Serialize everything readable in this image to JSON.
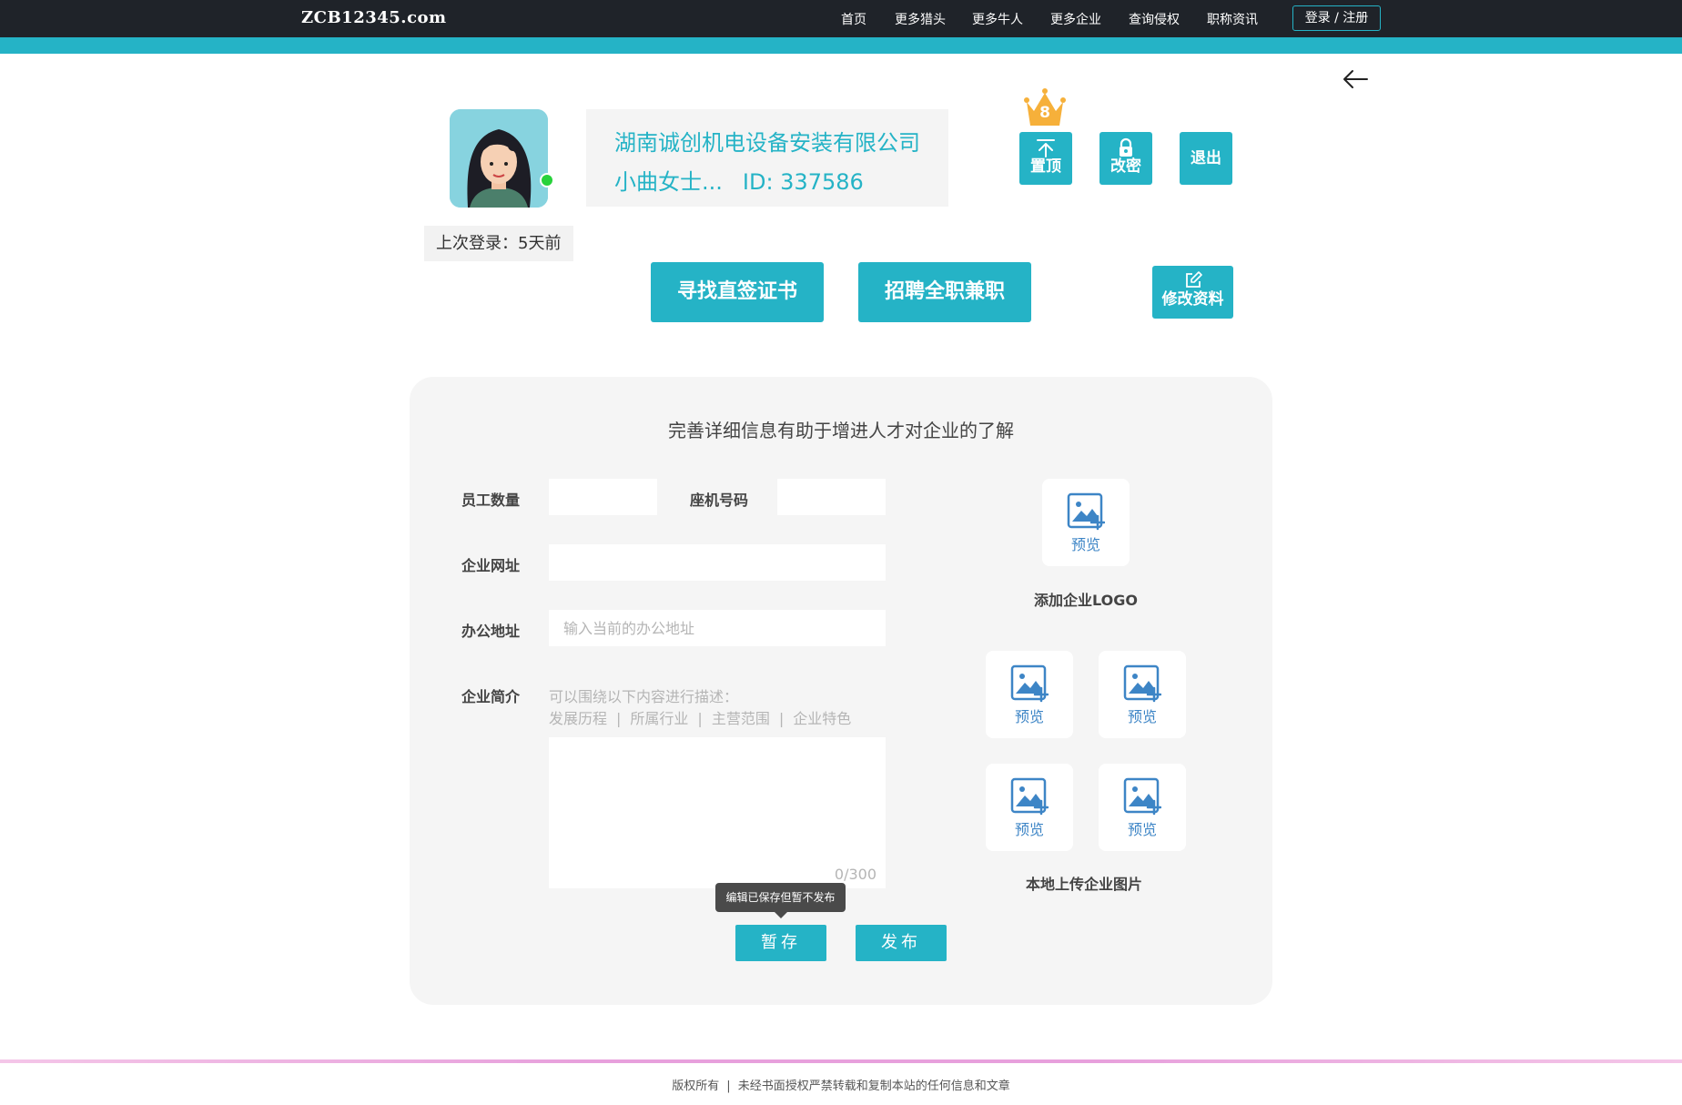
{
  "header": {
    "brand": "ZCB12345.com",
    "nav": [
      "首页",
      "更多猎头",
      "更多牛人",
      "更多企业",
      "查询侵权",
      "职称资讯"
    ],
    "login_label": "登录 / 注册"
  },
  "profile": {
    "company_name": "湖南诚创机电设备安装有限公司",
    "user_name": "小曲女士...",
    "user_id": "ID: 337586",
    "last_login": "上次登录：5天前",
    "crown_count": "8",
    "online": true
  },
  "actions": {
    "pin_label": "置顶",
    "change_pwd_label": "改密",
    "logout_label": "退出",
    "find_cert_label": "寻找直签证书",
    "recruit_label": "招聘全职兼职",
    "edit_profile_label": "修改资料"
  },
  "form": {
    "title": "完善详细信息有助于增进人才对企业的了解",
    "employees_label": "员工数量",
    "employees_value": "",
    "phone_label": "座机号码",
    "phone_value": "",
    "website_label": "企业网址",
    "website_value": "",
    "address_label": "办公地址",
    "address_placeholder": "输入当前的办公地址",
    "intro_label": "企业简介",
    "intro_hint": "可以围绕以下内容进行描述：",
    "intro_topics": [
      "发展历程",
      "所属行业",
      "主营范围",
      "企业特色"
    ],
    "intro_separator": "|",
    "intro_counter": "0/300",
    "tooltip": "编辑已保存但暂不发布",
    "save_label": "暂存",
    "publish_label": "发布"
  },
  "uploads": {
    "logo_preview": "预览",
    "logo_caption": "添加企业LOGO",
    "image_previews": [
      "预览",
      "预览",
      "预览",
      "预览"
    ],
    "images_caption": "本地上传企业图片"
  },
  "footer": {
    "copyright": "版权所有",
    "separator": "|",
    "notice": "未经书面授权严禁转载和复制本站的任何信息和文章"
  },
  "colors": {
    "accent": "#25b3c6",
    "topbar": "#1f2329",
    "preview_text": "#3d85c6",
    "online": "#27d23b"
  }
}
